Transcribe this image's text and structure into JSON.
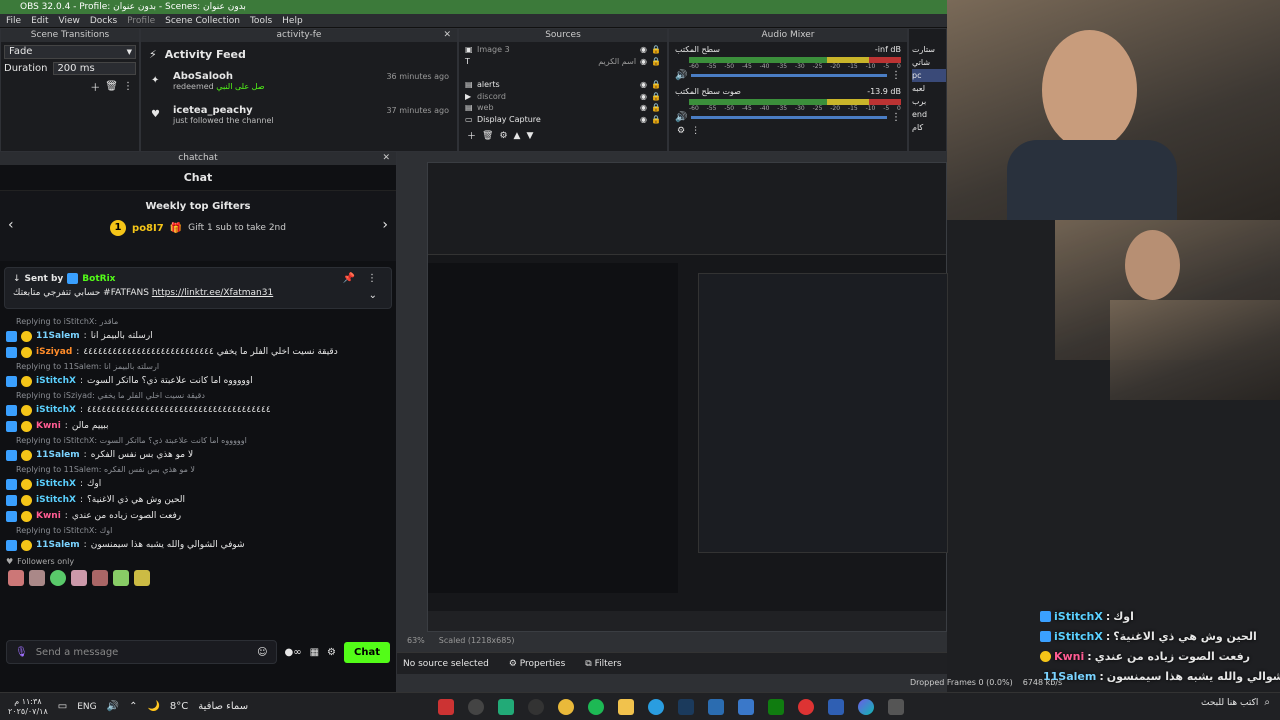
{
  "window": {
    "title": "OBS 32.0.4 - Profile: بدون عنوان - Scenes: بدون عنوان"
  },
  "menu": [
    "File",
    "Edit",
    "View",
    "Docks",
    "Profile",
    "Scene Collection",
    "Tools",
    "Help"
  ],
  "scene_transitions": {
    "title": "Scene Transitions",
    "transition": "Fade",
    "duration_label": "Duration",
    "duration_value": "200 ms"
  },
  "activity": {
    "dock_title": "activity-fe",
    "title": "Activity Feed",
    "items": [
      {
        "user": "AboSalooh",
        "action": "redeemed",
        "detail": "صل على النبي",
        "time": "36 minutes ago"
      },
      {
        "user": "icetea_peachy",
        "action": "just followed the channel",
        "time": "37 minutes ago"
      }
    ]
  },
  "sources": {
    "title": "Sources",
    "items": [
      "Image 3",
      "اسم الكريم",
      "alerts",
      "discord",
      "web",
      "Display Capture"
    ]
  },
  "mixer": {
    "title": "Audio Mixer",
    "channels": [
      {
        "name": "سطح المكتب",
        "db": "-inf dB"
      },
      {
        "name": "صوت سطح المكتب",
        "db": "-13.9 dB"
      }
    ],
    "scale": [
      "-60",
      "-55",
      "-50",
      "-45",
      "-40",
      "-35",
      "-30",
      "-25",
      "-20",
      "-15",
      "-10",
      "-5",
      "0"
    ]
  },
  "scenes_right": [
    "ستارت",
    "شاتي",
    "pc",
    "لعبه",
    "برب",
    "end",
    "كام"
  ],
  "chat": {
    "dock_title": "chatchat",
    "title": "Chat",
    "gifters_title": "Weekly top Gifters",
    "gifter_name": "po8I7",
    "gifter_count": "1",
    "gift_text": "Gift 1 sub to take 2nd",
    "pinned_by_label": "Sent by",
    "pinned_by": "BotRix",
    "pinned_text": "حسابي تتفرجي متابعتك #FATFANS",
    "pinned_link": "https://linktr.ee/Xfatman31",
    "messages": [
      {
        "reply": "Replying to iStitchX: ماقدر",
        "user": "11Salem",
        "color": "#7ad3ff",
        "text": "ارسلته بالبيمز انا"
      },
      {
        "reply": "",
        "user": "iSziyad",
        "color": "#ff8c2a",
        "text": "دقيقة نسيت اخلي الفلر ما يخفي ٤٤٤٤٤٤٤٤٤٤٤٤٤٤٤٤٤٤٤٤٤٤٤٤٤٤٤"
      },
      {
        "reply": "Replying to 11Salem: ارسلته بالبيمز انا",
        "user": "iStitchX",
        "color": "#5bd1ff",
        "text": "اوووووه اما كانت علاعبتة ذي؟ مااتكر السوت"
      },
      {
        "reply": "Replying to iSziyad: دقيقة نسيت اخلي الفلر ما يخفي",
        "user": "iStitchX",
        "color": "#5bd1ff",
        "text": "٤٤٤٤٤٤٤٤٤٤٤٤٤٤٤٤٤٤٤٤٤٤٤٤٤٤٤٤٤٤٤٤٤٤٤٤٤٤"
      },
      {
        "reply": "",
        "user": "Kwni",
        "color": "#ff5c93",
        "text": "ببييم مالن"
      },
      {
        "reply": "Replying to iStitchX: اوووووه اما كانت علاعبتة ذي؟ مااتكر السوت",
        "user": "11Salem",
        "color": "#7ad3ff",
        "text": "لا مو هذي بس نفس الفكره"
      },
      {
        "reply": "Replying to 11Salem: لا مو هذي بس نفس الفكره",
        "user": "iStitchX",
        "color": "#5bd1ff",
        "text": "اوك"
      },
      {
        "reply": "",
        "user": "iStitchX",
        "color": "#5bd1ff",
        "text": "الحين وش هي ذي الاغنية؟"
      },
      {
        "reply": "",
        "user": "Kwni",
        "color": "#ff5c93",
        "text": "رفعت الصوت زياده من عندي"
      },
      {
        "reply": "Replying to iStitchX: اوك",
        "user": "11Salem",
        "color": "#7ad3ff",
        "text": "شوفي الشوالي والله يشبه هذا سيمنسون"
      }
    ],
    "followers_only": "Followers only",
    "send_placeholder": "Send a message",
    "chat_button": "Chat"
  },
  "preview": {
    "zoom": "63%",
    "scaled": "Scaled (1218x685)",
    "no_source": "No source selected",
    "properties": "Properties",
    "filters": "Filters"
  },
  "status": {
    "dropped": "Dropped Frames 0 (0.0%)",
    "bitrate": "6748 kb/s"
  },
  "overlay_chat": [
    {
      "user": "iStitchX",
      "text": "اوك"
    },
    {
      "user": "iStitchX",
      "text": "الحين وش هي ذي الاغنية؟"
    },
    {
      "user": "Kwni",
      "text": "رفعت الصوت زياده من عندي"
    },
    {
      "user": "11Salem",
      "text": "شوفي الشوالي والله يشبه هذا سيمنسون"
    }
  ],
  "taskbar": {
    "time": "١١:٣٨ م",
    "date": "٢٠٢٥/٠٧/١٨",
    "lang": "ENG",
    "weather_temp": "8°C",
    "weather_text": "سماء صافية",
    "search_placeholder": "اكتب هنا للبحث"
  },
  "colors": {
    "kick_green": "#53fc18",
    "obs_green": "#3c7a3a"
  }
}
